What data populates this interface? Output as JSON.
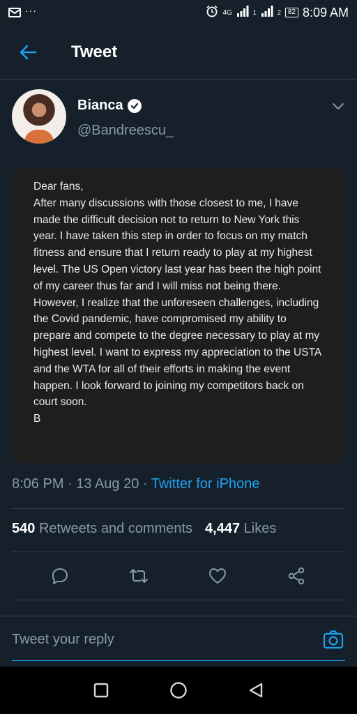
{
  "status_bar": {
    "network_label": "4G",
    "sim1": "1",
    "sim2": "2",
    "battery": "82",
    "time": "8:09 AM",
    "overflow": "···"
  },
  "header": {
    "title": "Tweet"
  },
  "author": {
    "name": "Bianca",
    "handle": "@Bandreescu_"
  },
  "letter": {
    "greeting": "Dear fans,",
    "body": "After many discussions with those closest to me, I have made the difficult decision not to return to New York this year. I have taken this step in order to focus on my match fitness and ensure that I return ready to play at my highest level. The US Open victory last year has been the high point of my career thus far and I will miss not being there. However, I realize that the unforeseen challenges, including the Covid pandemic, have compromised my ability to prepare and compete to the degree necessary to play at my highest level. I want to express my appreciation to the USTA and the WTA for all of their efforts in making the event happen. I look forward to joining my competitors back on court soon.",
    "signoff": "B"
  },
  "meta": {
    "time": "8:06 PM",
    "date": "13 Aug 20",
    "separator": " · ",
    "source": "Twitter for iPhone"
  },
  "stats": {
    "retweets_count": "540",
    "retweets_label": "Retweets and comments",
    "likes_count": "4,447",
    "likes_label": "Likes"
  },
  "composer": {
    "placeholder": "Tweet your reply"
  },
  "colors": {
    "background": "#15202b",
    "accent": "#1da1f2",
    "muted": "#8899a6",
    "divider": "#38444d"
  }
}
